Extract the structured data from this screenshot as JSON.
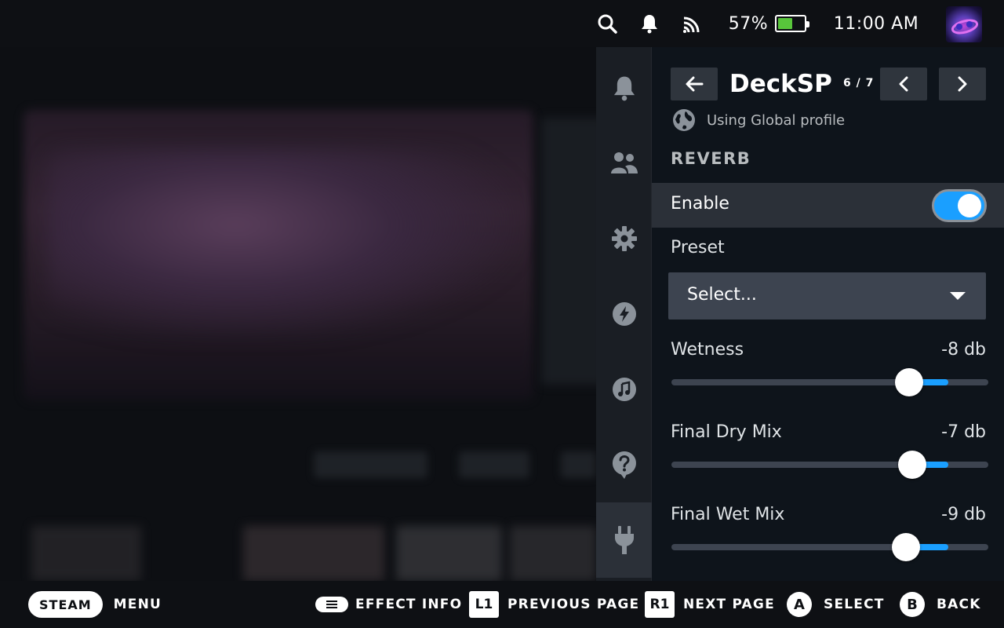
{
  "status_bar": {
    "battery_percent_label": "57%",
    "battery_level": 0.57,
    "clock": "11:00 AM",
    "icons": [
      "search-icon",
      "bell-icon",
      "wifi-icon",
      "battery-icon",
      "avatar"
    ]
  },
  "rail": {
    "items": [
      {
        "name": "notifications",
        "icon": "bell-icon"
      },
      {
        "name": "friends",
        "icon": "friends-icon"
      },
      {
        "name": "settings",
        "icon": "gear-icon"
      },
      {
        "name": "performance",
        "icon": "lightning-icon"
      },
      {
        "name": "music",
        "icon": "music-icon"
      },
      {
        "name": "help",
        "icon": "help-icon"
      },
      {
        "name": "plugins",
        "icon": "plug-icon",
        "active": true
      }
    ]
  },
  "panel": {
    "title": "DeckSP",
    "page_indicator": "6 / 7",
    "profile_text": "Using Global profile",
    "section_title": "REVERB",
    "enable": {
      "label": "Enable",
      "on": true
    },
    "preset": {
      "label": "Preset",
      "value": "Select..."
    },
    "sliders": [
      {
        "label": "Wetness",
        "value": "-8 db",
        "position": 0.75
      },
      {
        "label": "Final Dry Mix",
        "value": "-7 db",
        "position": 0.76
      },
      {
        "label": "Final Wet Mix",
        "value": "-9 db",
        "position": 0.74
      }
    ]
  },
  "bottom_bar": {
    "steam_key": "STEAM",
    "menu_label": "MENU",
    "effect_info_label": "EFFECT INFO",
    "l1_key": "L1",
    "prev_label": "PREVIOUS PAGE",
    "r1_key": "R1",
    "next_label": "NEXT PAGE",
    "a_key": "A",
    "select_label": "SELECT",
    "b_key": "B",
    "back_label": "BACK"
  },
  "colors": {
    "accent": "#1a9fff",
    "battery_green": "#58c53b",
    "panel_bg": "#0e141b",
    "row_highlight": "#2b3038"
  }
}
